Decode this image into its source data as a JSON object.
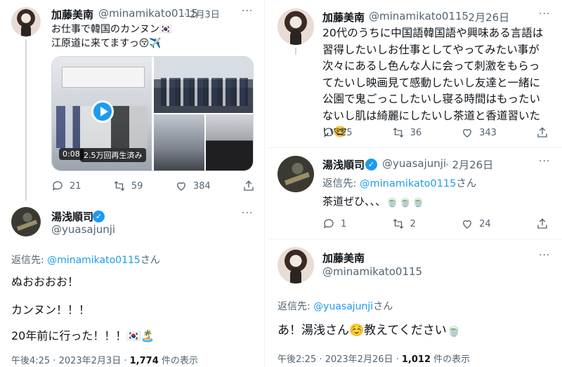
{
  "left": {
    "tweet1": {
      "name": "加藤美南",
      "handle": "@minamikato0115",
      "date": "· 2月3日",
      "more": "···",
      "line1": "お仕事で韓国のカンヌン🇰🇷",
      "line2": "江原道に来てますっ😚✈️",
      "video_duration": "0:08",
      "video_views": "2.5万回再生済み",
      "replies": "21",
      "retweets": "59",
      "likes": "384"
    },
    "tweet2": {
      "name": "湯浅順司",
      "handle": "@yuasajunji",
      "more": "···",
      "reply_prefix": "返信先: ",
      "reply_to": "@minamikato0115",
      "reply_suffix": "さん",
      "line1": "ぬおおおお！",
      "line2": "カンヌン！！！",
      "line3": "20年前に行った！！！🇰🇷🏝️",
      "time": "午後4:25 · 2023年2月3日 · ",
      "views_count": "1,774",
      "views_label": " 件の表示"
    }
  },
  "right": {
    "tweet1": {
      "name": "加藤美南",
      "handle": "@minamikato0115",
      "date": "· 2月26日",
      "more": "···",
      "body": "20代のうちに中国語韓国語や興味ある言語は習得したいしお仕事としてやってみたい事が次々にあるし色んな人に会って刺激をもらってたいし映画見て感動したいし友達と一緒に公園で鬼ごっこしたいし寝る時間はもったいないし肌は綺麗にしたいし茶道と香道習いたい🤓",
      "replies": "25",
      "retweets": "36",
      "likes": "343"
    },
    "tweet2": {
      "name": "湯浅順司",
      "handle": "@yuasajunji",
      "date": "· 2月26日",
      "more": "···",
      "reply_prefix": "返信先: ",
      "reply_to": "@minamikato0115",
      "reply_suffix": "さん",
      "body": "茶道ぜひ、、、🍵🍵🍵",
      "replies": "1",
      "retweets": "2",
      "likes": "24"
    },
    "tweet3": {
      "name": "加藤美南",
      "handle": "@minamikato0115",
      "more": "···",
      "reply_prefix": "返信先: ",
      "reply_to": "@yuasajunji",
      "reply_suffix": "さん",
      "body": "あ！湯浅さん☺️教えてください🍵",
      "time": "午後2:25 · 2023年2月26日 · ",
      "views_count": "1,012",
      "views_label": " 件の表示"
    }
  },
  "colors": {
    "accent": "#1d9bf0",
    "muted": "#536471",
    "text": "#0f1419"
  }
}
